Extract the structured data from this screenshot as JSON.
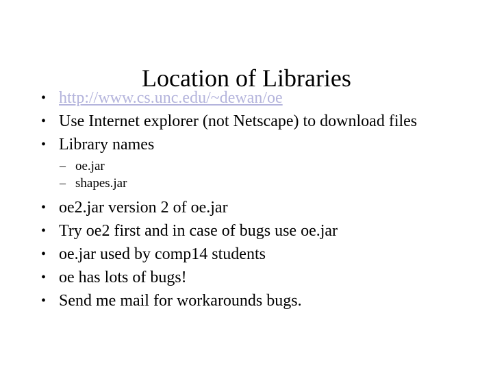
{
  "slide": {
    "title": "Location of Libraries",
    "background_color": "#ffffff",
    "text_color": "#000000",
    "link_color": "#b4b4dc",
    "bullet_marker": "•",
    "sub_bullet_marker": "–",
    "bullets": [
      {
        "level": 1,
        "type": "link",
        "text": "http://www.cs.unc.edu/~dewan/oe"
      },
      {
        "level": 1,
        "type": "text",
        "text": "Use Internet explorer (not Netscape) to download files"
      },
      {
        "level": 1,
        "type": "text",
        "text": "Library names"
      },
      {
        "level": 2,
        "type": "text",
        "text": "oe.jar"
      },
      {
        "level": 2,
        "type": "text",
        "text": "shapes.jar"
      },
      {
        "level": 1,
        "type": "text",
        "text": "oe2.jar version 2 of oe.jar"
      },
      {
        "level": 1,
        "type": "text",
        "text": "Try oe2 first and in case of bugs use oe.jar"
      },
      {
        "level": 1,
        "type": "text",
        "text": "oe.jar used by comp14 students"
      },
      {
        "level": 1,
        "type": "text",
        "text": "oe has lots of bugs!"
      },
      {
        "level": 1,
        "type": "text",
        "text": "Send me mail for workarounds bugs."
      }
    ]
  }
}
